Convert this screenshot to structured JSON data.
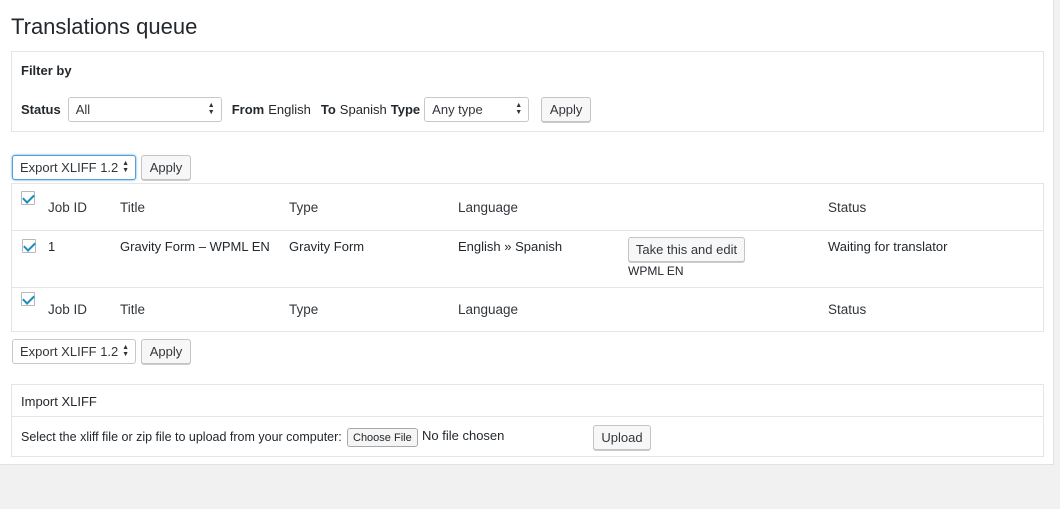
{
  "page": {
    "title": "Translations queue"
  },
  "filter": {
    "heading": "Filter by",
    "status_label": "Status",
    "status_value": "All",
    "from_label": "From",
    "from_value": "English",
    "to_label": "To",
    "to_value": "Spanish",
    "type_label": "Type",
    "type_value": "Any type",
    "apply_label": "Apply"
  },
  "bulk_top": {
    "action_value": "Export XLIFF 1.2",
    "apply_label": "Apply"
  },
  "bulk_bottom": {
    "action_value": "Export XLIFF 1.2",
    "apply_label": "Apply"
  },
  "table": {
    "columns": {
      "job_id": "Job ID",
      "title": "Title",
      "type": "Type",
      "language": "Language",
      "status": "Status"
    },
    "rows": [
      {
        "checked": true,
        "job_id": "1",
        "title": "Gravity Form – WPML EN",
        "type": "Gravity Form",
        "language": "English » Spanish",
        "action_label": "Take this and edit",
        "action_sub": "WPML EN",
        "status": "Waiting for translator"
      }
    ]
  },
  "import": {
    "title": "Import XLIFF",
    "instruction": "Select the xliff file or zip file to upload from your computer:",
    "choose_label": "Choose File",
    "file_status": "No file chosen",
    "upload_label": "Upload"
  },
  "colors": {
    "accent": "#1e8cbe",
    "border": "#e5e5e5",
    "background": "#f1f1f1"
  }
}
